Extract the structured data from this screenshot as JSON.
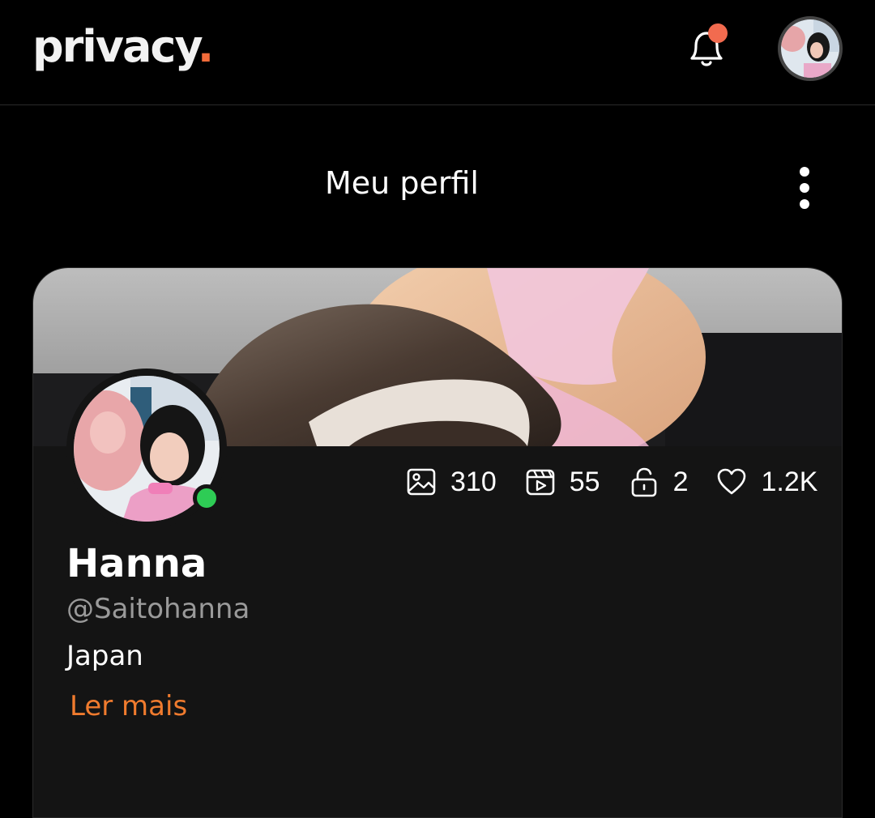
{
  "header": {
    "logo_text": "privacy",
    "logo_dot": ".",
    "brand_color": "#f26b3a",
    "notification_icon": "bell-icon",
    "has_unread_notifications": true
  },
  "page": {
    "title": "Meu perfil",
    "menu_icon": "more-vertical-icon"
  },
  "profile": {
    "name": "Hanna",
    "handle": "@Saitohanna",
    "location": "Japan",
    "read_more": "Ler mais",
    "online": true,
    "online_color": "#2ecc55"
  },
  "stats": [
    {
      "icon": "image-icon",
      "value": "310"
    },
    {
      "icon": "video-icon",
      "value": "55"
    },
    {
      "icon": "lock-icon",
      "value": "2"
    },
    {
      "icon": "heart-icon",
      "value": "1.2K"
    }
  ]
}
